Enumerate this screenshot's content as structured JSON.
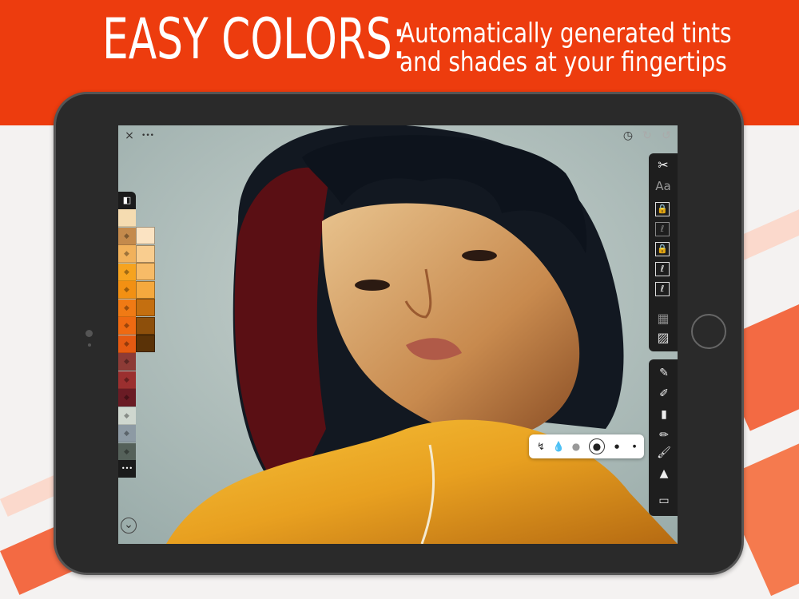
{
  "banner": {
    "title": "EASY COLORS:",
    "subtitle_line1": "Automatically generated tints",
    "subtitle_line2": "and shades at your fingertips",
    "bg_color": "#ed3c0e"
  },
  "canvas": {
    "top_left": {
      "close": "×",
      "more": "•••"
    },
    "top_right": {
      "timer": "◷",
      "redo": "↻",
      "undo": "↺"
    },
    "bottom_left": {
      "collapse": "⌄"
    }
  },
  "palette": {
    "header_icon": "palette-icon",
    "swatches": [
      "#f5dcb1",
      "#c48a4c",
      "#f1b15b",
      "#f6a31f",
      "#f29013",
      "#f07a14",
      "#ee6a12",
      "#e45a12",
      "#8d3b36",
      "#9b2f2f",
      "#6a1b24",
      "#cfd7cf",
      "#8d9aa4",
      "#55615a"
    ],
    "tints": [
      "#fbe3c2",
      "#f9cd8f",
      "#f7bb67",
      "#f5a93e",
      "#c46f10",
      "#8d4f0b",
      "#5a3207"
    ],
    "more": "•••"
  },
  "toolbar": {
    "tools": [
      "scissors-icon",
      "text-icon",
      "layer-lock-1",
      "layer-2",
      "layer-lock-3",
      "layer-4",
      "layer-5",
      "grid-icon",
      "texture-icon"
    ],
    "text_label": "Aa"
  },
  "brushes": [
    "pen",
    "fineliner",
    "marker",
    "brush",
    "paint",
    "airbrush",
    "eraser"
  ],
  "brush_popup": {
    "items": [
      "smudge",
      "opacity",
      "blend",
      "size-large",
      "size-medium",
      "size-small"
    ]
  }
}
